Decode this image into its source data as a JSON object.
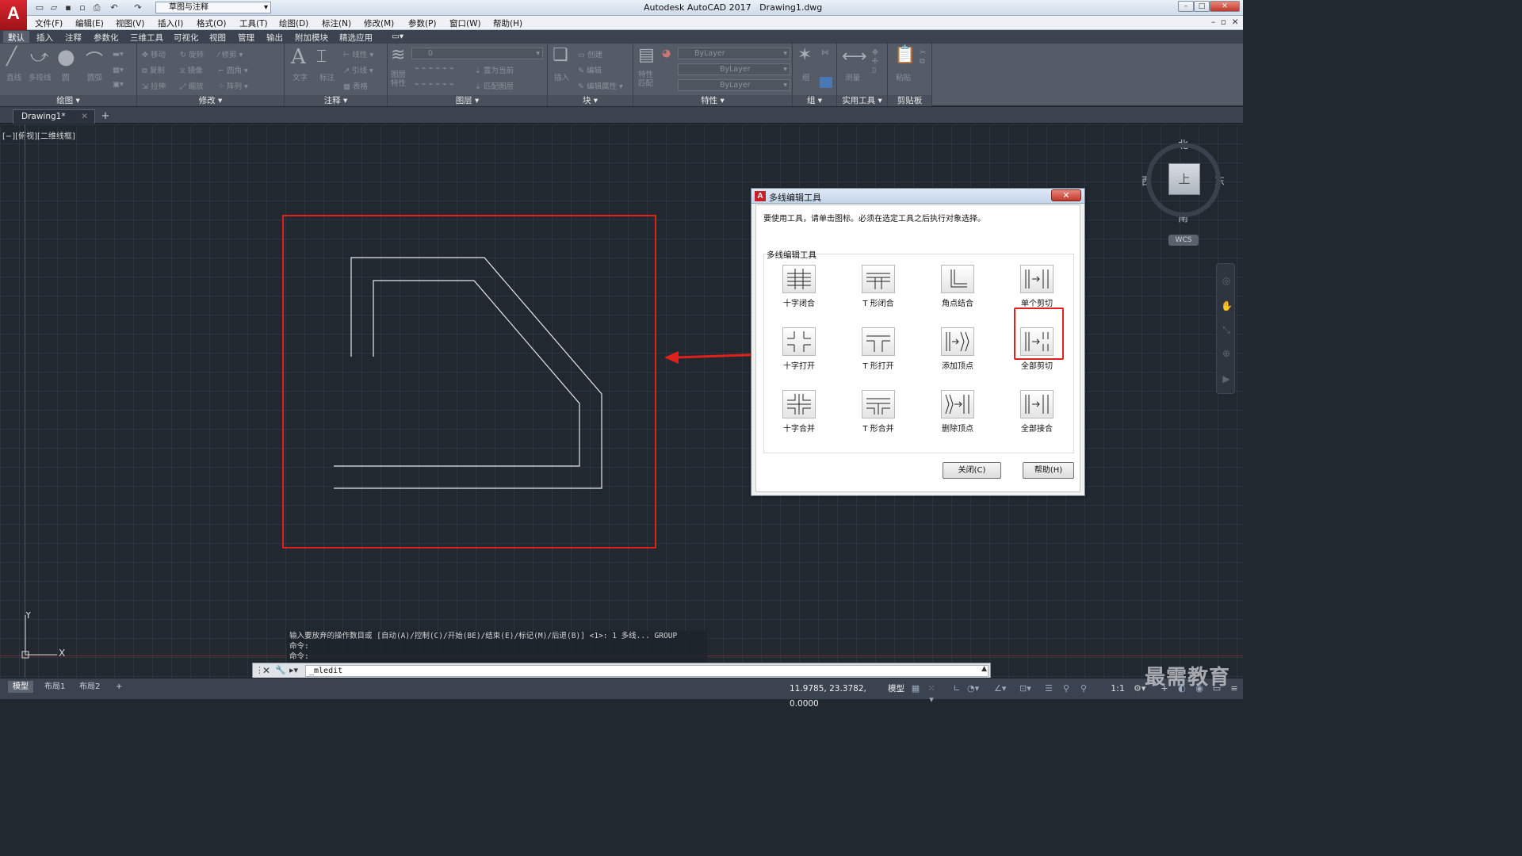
{
  "app": {
    "title": "Autodesk AutoCAD 2017",
    "file": "Drawing1.dwg",
    "logo_letter": "A",
    "workspace": "草图与注释"
  },
  "menus": [
    "文件(F)",
    "编辑(E)",
    "视图(V)",
    "插入(I)",
    "格式(O)",
    "工具(T)",
    "绘图(D)",
    "标注(N)",
    "修改(M)",
    "参数(P)",
    "窗口(W)",
    "帮助(H)"
  ],
  "ribbon_tabs": [
    "默认",
    "插入",
    "注释",
    "参数化",
    "三维工具",
    "可视化",
    "视图",
    "管理",
    "输出",
    "附加模块",
    "精选应用"
  ],
  "ribbon_panels": {
    "draw": {
      "label": "绘图 ▾",
      "tools": [
        "直线",
        "多段线",
        "圆",
        "圆弧"
      ]
    },
    "modify": {
      "label": "修改 ▾",
      "tools": [
        "移动",
        "旋转",
        "修剪",
        "复制",
        "镜像",
        "圆角",
        "拉伸",
        "缩放",
        "阵列"
      ]
    },
    "annotate": {
      "label": "注释 ▾",
      "tools": [
        "文字",
        "标注",
        "线性",
        "引线",
        "表格"
      ]
    },
    "layers": {
      "label": "图层 ▾",
      "tools": [
        "图层特性",
        "置为当前",
        "匹配图层"
      ],
      "current_layer": "0"
    },
    "block": {
      "label": "块 ▾",
      "tools": [
        "插入",
        "创建",
        "编辑",
        "编辑属性"
      ]
    },
    "properties": {
      "label": "特性 ▾",
      "tools": [
        "特性匹配"
      ],
      "color": "ByLayer",
      "linetype": "ByLayer",
      "lineweight": "ByLayer"
    },
    "group": {
      "label": "组 ▾",
      "tools": [
        "组"
      ]
    },
    "utilities": {
      "label": "实用工具 ▾",
      "tools": [
        "测量"
      ]
    },
    "clipboard": {
      "label": "剪贴板",
      "tools": [
        "粘贴"
      ]
    }
  },
  "doc_tab": "Drawing1*",
  "viewport_label": "[−][俯视][二维线框]",
  "viewcube": {
    "north": "北",
    "south": "南",
    "east": "东",
    "west": "西",
    "face": "上",
    "wcs": "WCS"
  },
  "ucs": {
    "x": "X",
    "y": "Y"
  },
  "dialog": {
    "title": "多线编辑工具",
    "instruction": "要使用工具，请单击图标。必须在选定工具之后执行对象选择。",
    "group_label": "多线编辑工具",
    "tools": [
      "十字闭合",
      "T 形闭合",
      "角点结合",
      "单个剪切",
      "十字打开",
      "T 形打开",
      "添加顶点",
      "全部剪切",
      "十字合并",
      "T 形合并",
      "删除顶点",
      "全部接合"
    ],
    "highlighted_tool": "全部剪切",
    "close_label": "关闭(C)",
    "help_label": "帮助(H)"
  },
  "command_history": [
    "输入要放弃的操作数目或 [自动(A)/控制(C)/开始(BE)/结束(E)/标记(M)/后退(B)] <1>: 1 多线... GROUP",
    "命令:",
    "命令:"
  ],
  "command_input": "_mledit",
  "layout_tabs": [
    "模型",
    "布局1",
    "布局2"
  ],
  "status": {
    "coords": "11.9785, 23.3782, 0.0000",
    "space": "模型",
    "scale": "1:1"
  },
  "watermark": "最需教育",
  "colors": {
    "highlight_red": "#e0201b",
    "canvas_bg": "#212830",
    "ribbon_bg": "#555c67"
  }
}
